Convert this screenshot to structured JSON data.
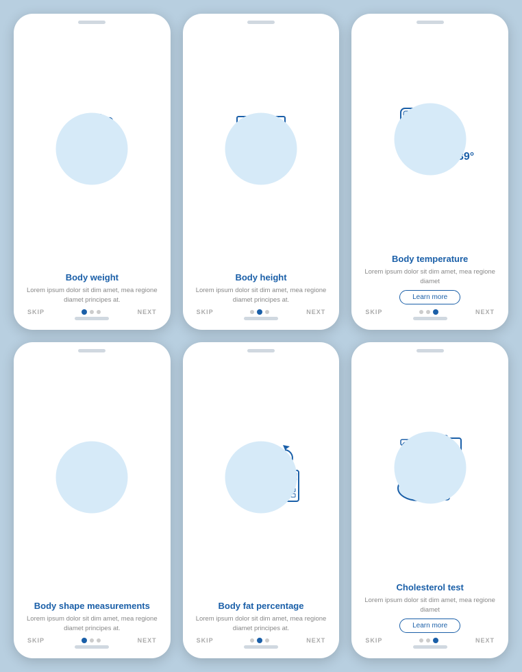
{
  "cards": [
    {
      "id": "body-weight",
      "title": "Body weight",
      "description": "Lorem ipsum dolor sit dim amet, mea regione diamet principes at.",
      "show_learn_more": false,
      "nav": {
        "skip": "SKIP",
        "next": "NEXT",
        "dots": [
          true,
          false,
          false
        ]
      }
    },
    {
      "id": "body-height",
      "title": "Body height",
      "description": "Lorem ipsum dolor sit dim amet, mea regione diamet principes at.",
      "show_learn_more": false,
      "nav": {
        "skip": "SKIP",
        "next": "NEXT",
        "dots": [
          false,
          true,
          false
        ]
      }
    },
    {
      "id": "body-temperature",
      "title": "Body temperature",
      "description": "Lorem ipsum dolor sit dim amet, mea regione diamet",
      "show_learn_more": true,
      "learn_more_label": "Learn more",
      "nav": {
        "skip": "SKIP",
        "next": "NEXT",
        "dots": [
          false,
          false,
          true
        ]
      }
    },
    {
      "id": "body-shape",
      "title": "Body shape measurements",
      "description": "Lorem ipsum dolor sit dim amet, mea regione diamet principes at.",
      "show_learn_more": false,
      "nav": {
        "skip": "SKIP",
        "next": "NEXT",
        "dots": [
          true,
          false,
          false
        ]
      }
    },
    {
      "id": "body-fat",
      "title": "Body fat percentage",
      "description": "Lorem ipsum dolor sit dim amet, mea regione diamet principes at.",
      "show_learn_more": false,
      "nav": {
        "skip": "SKIP",
        "next": "NEXT",
        "dots": [
          false,
          true,
          false
        ]
      }
    },
    {
      "id": "cholesterol",
      "title": "Cholesterol test",
      "description": "Lorem ipsum dolor sit dim amet, mea regione diamet",
      "show_learn_more": true,
      "learn_more_label": "Learn more",
      "nav": {
        "skip": "SKIP",
        "next": "NEXT",
        "dots": [
          false,
          false,
          true
        ]
      }
    }
  ]
}
